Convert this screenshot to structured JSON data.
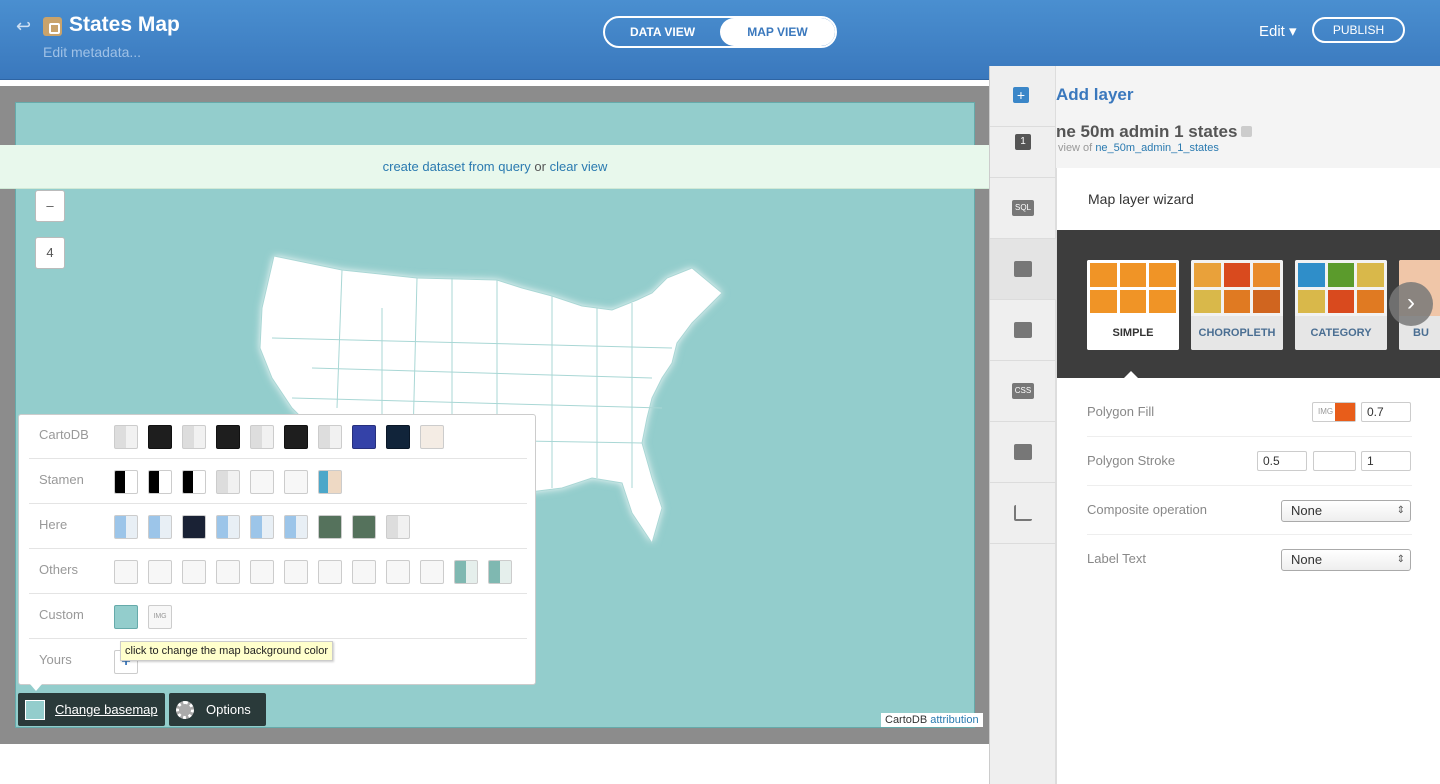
{
  "header": {
    "title": "States Map",
    "metadata_link": "Edit metadata...",
    "views": [
      "DATA VIEW",
      "MAP VIEW"
    ],
    "edit_menu": "Edit ▾",
    "publish": "PUBLISH"
  },
  "map": {
    "query_bar": {
      "create": "create dataset from query",
      "or": "or",
      "clear": "clear view"
    },
    "zoom_out": "–",
    "zoom_level": "4",
    "basemap_button": "Change basemap",
    "options_button": "Options",
    "attribution_prefix": "CartoDB",
    "attribution_link": "attribution",
    "tooltip": "click to change the map background color",
    "background_color": "#93cdcc"
  },
  "basemap_panel": {
    "rows": [
      {
        "label": "CartoDB"
      },
      {
        "label": "Stamen"
      },
      {
        "label": "Here"
      },
      {
        "label": "Others"
      },
      {
        "label": "Custom"
      },
      {
        "label": "Yours"
      }
    ],
    "custom_img": "IMG",
    "yours_add": "+"
  },
  "sidebar": {
    "add_layer": "Add layer",
    "add_icon": "+",
    "layer_number": "1",
    "layer_name": "ne 50m admin 1 states",
    "view_of": "view of",
    "view_of_table": "ne_50m_admin_1_states",
    "rail": [
      "SQL",
      "",
      "",
      "CSS",
      "",
      ""
    ]
  },
  "wizard": {
    "title": "Map layer wizard",
    "types": [
      "SIMPLE",
      "CHOROPLETH",
      "CATEGORY",
      "BU"
    ],
    "next_icon": "›",
    "properties": [
      {
        "label": "Polygon Fill"
      },
      {
        "label": "Polygon Stroke"
      },
      {
        "label": "Composite operation"
      },
      {
        "label": "Label Text"
      }
    ],
    "polygon_fill": {
      "img": "IMG",
      "opacity": "0.7",
      "color": "#e85d1a"
    },
    "polygon_stroke": {
      "width": "0.5",
      "opacity": "1"
    },
    "composite": "None",
    "label_text": "None"
  }
}
